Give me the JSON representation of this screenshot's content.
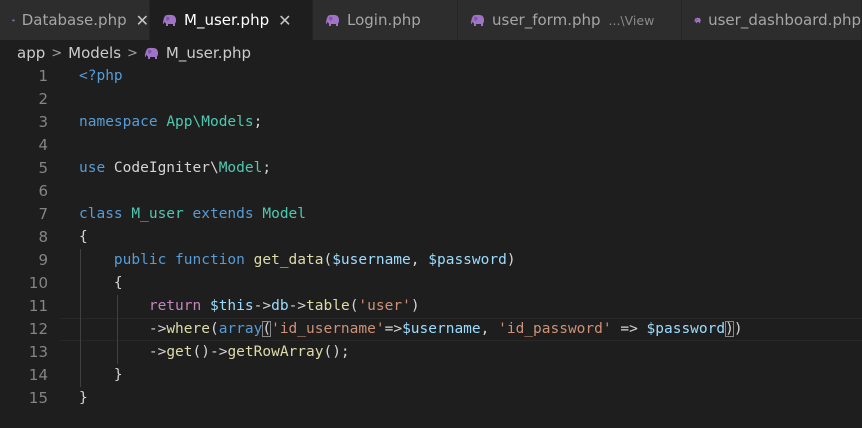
{
  "tabs": [
    {
      "label": "Database.php",
      "active": false,
      "close": "✕",
      "description": ""
    },
    {
      "label": "M_user.php",
      "active": true,
      "close": "✕",
      "description": ""
    },
    {
      "label": "Login.php",
      "active": false,
      "close": "",
      "description": ""
    },
    {
      "label": "user_form.php",
      "active": false,
      "close": "",
      "description": "...\\View"
    },
    {
      "label": "user_dashboard.php",
      "active": false,
      "close": "",
      "description": ""
    }
  ],
  "breadcrumb": {
    "items": [
      "app",
      "Models",
      "M_user.php"
    ],
    "separator": ">"
  },
  "editor": {
    "line_numbers": [
      "1",
      "2",
      "3",
      "4",
      "5",
      "6",
      "7",
      "8",
      "9",
      "10",
      "11",
      "12",
      "13",
      "14",
      "15"
    ],
    "lines": [
      [
        {
          "t": "<?php",
          "c": "kw"
        }
      ],
      [],
      [
        {
          "t": "namespace",
          "c": "kw"
        },
        {
          "t": " ",
          "c": "pl"
        },
        {
          "t": "App\\Models",
          "c": "cls"
        },
        {
          "t": ";",
          "c": "pl"
        }
      ],
      [],
      [
        {
          "t": "use",
          "c": "kw"
        },
        {
          "t": " CodeIgniter\\",
          "c": "pl"
        },
        {
          "t": "Model",
          "c": "cls"
        },
        {
          "t": ";",
          "c": "pl"
        }
      ],
      [],
      [
        {
          "t": "class",
          "c": "kw"
        },
        {
          "t": " ",
          "c": "pl"
        },
        {
          "t": "M_user",
          "c": "cls"
        },
        {
          "t": " ",
          "c": "pl"
        },
        {
          "t": "extends",
          "c": "kw"
        },
        {
          "t": " ",
          "c": "pl"
        },
        {
          "t": "Model",
          "c": "cls"
        }
      ],
      [
        {
          "t": "{",
          "c": "pl"
        }
      ],
      [
        {
          "t": "    ",
          "c": "pl"
        },
        {
          "t": "public",
          "c": "kw"
        },
        {
          "t": " ",
          "c": "pl"
        },
        {
          "t": "function",
          "c": "kw"
        },
        {
          "t": " ",
          "c": "pl"
        },
        {
          "t": "get_data",
          "c": "fn"
        },
        {
          "t": "(",
          "c": "pl"
        },
        {
          "t": "$username",
          "c": "var"
        },
        {
          "t": ", ",
          "c": "pl"
        },
        {
          "t": "$password",
          "c": "var"
        },
        {
          "t": ")",
          "c": "pl"
        }
      ],
      [
        {
          "t": "    {",
          "c": "pl"
        }
      ],
      [
        {
          "t": "        ",
          "c": "pl"
        },
        {
          "t": "return",
          "c": "ctl"
        },
        {
          "t": " ",
          "c": "pl"
        },
        {
          "t": "$this",
          "c": "var"
        },
        {
          "t": "->",
          "c": "pl"
        },
        {
          "t": "db",
          "c": "var"
        },
        {
          "t": "->",
          "c": "pl"
        },
        {
          "t": "table",
          "c": "fn"
        },
        {
          "t": "(",
          "c": "pl"
        },
        {
          "t": "'user'",
          "c": "str"
        },
        {
          "t": ")",
          "c": "pl"
        }
      ],
      [
        {
          "t": "        ->",
          "c": "pl"
        },
        {
          "t": "where",
          "c": "fn"
        },
        {
          "t": "(",
          "c": "pl"
        },
        {
          "t": "array",
          "c": "kw"
        },
        {
          "t": "(",
          "c": "brk"
        },
        {
          "t": "'id_username'",
          "c": "str"
        },
        {
          "t": "=>",
          "c": "pl"
        },
        {
          "t": "$username",
          "c": "var"
        },
        {
          "t": ", ",
          "c": "pl"
        },
        {
          "t": "'id_password'",
          "c": "str"
        },
        {
          "t": " => ",
          "c": "pl"
        },
        {
          "t": "$password",
          "c": "var"
        },
        {
          "t": ")",
          "c": "brk"
        },
        {
          "t": ")",
          "c": "pl"
        }
      ],
      [
        {
          "t": "        ->",
          "c": "pl"
        },
        {
          "t": "get",
          "c": "fn"
        },
        {
          "t": "()->",
          "c": "pl"
        },
        {
          "t": "getRowArray",
          "c": "fn"
        },
        {
          "t": "();",
          "c": "pl"
        }
      ],
      [
        {
          "t": "    }",
          "c": "pl"
        }
      ],
      [
        {
          "t": "}",
          "c": "pl"
        }
      ]
    ],
    "cursor_line": 12
  },
  "colors": {
    "background": "#1e1e1e",
    "keyword": "#569cd6",
    "control": "#c586c0",
    "function": "#dcdcaa",
    "class": "#4ec9b0",
    "variable": "#9cdcfe",
    "string": "#ce9178",
    "php_icon": "#a074c4"
  },
  "icons": {
    "file": "php-elephant-icon",
    "close": "close-icon",
    "separator": "chevron-right-icon"
  }
}
